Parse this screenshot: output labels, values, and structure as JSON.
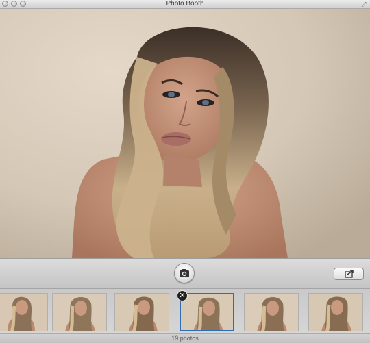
{
  "window": {
    "title": "Photo Booth"
  },
  "viewer": {
    "subject": "live camera preview"
  },
  "toolbar": {
    "shutter_icon": "camera-icon",
    "share_icon": "share-icon"
  },
  "thumbnails": {
    "count": 6,
    "selected_index": 3
  },
  "status": {
    "photo_count": "19 photos"
  },
  "colors": {
    "selection": "#2f6db5",
    "toolbar": "#d4d4d4"
  }
}
